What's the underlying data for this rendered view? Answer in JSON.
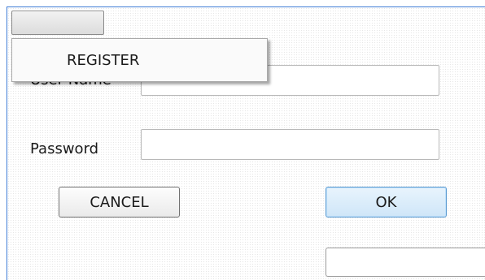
{
  "menu": {
    "button_label": "",
    "items": [
      {
        "label": "REGISTER"
      }
    ]
  },
  "form": {
    "username": {
      "label": "User Name",
      "value": ""
    },
    "password": {
      "label": "Password",
      "value": ""
    }
  },
  "buttons": {
    "cancel_label": "CANCEL",
    "ok_label": "OK"
  },
  "status": {
    "value": ""
  }
}
